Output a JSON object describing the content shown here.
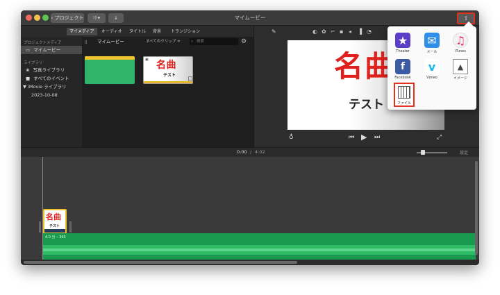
{
  "titlebar": {
    "back_label": "‹ プロジェクト",
    "view_label": "⁝⁝⁝▾",
    "import_icon": "↓",
    "title": "マイムービー",
    "share_icon": "⇧"
  },
  "browser": {
    "tabs": [
      "マイメディア",
      "オーディオ",
      "タイトル",
      "背景",
      "トランジション"
    ],
    "active_tab": 0
  },
  "sidebar": {
    "project_media_header": "プロジェクトメディア",
    "project_item": "マイムービー",
    "library_header": "ライブラリ",
    "library_items": [
      "写真ライブラリ",
      "すべてのイベント"
    ],
    "imovie_library": "▼ iMovie ライブラリ",
    "event_date": "2023-10-08"
  },
  "content": {
    "title": "マイムービー",
    "filter": "すべてのクリップ ≑",
    "search_placeholder": "検索",
    "clip_title_main": "名曲",
    "clip_title_sub": "テスト"
  },
  "viewer": {
    "title_main": "名曲",
    "title_sub": "テスト"
  },
  "share_menu": {
    "items": [
      "Theater",
      "メール",
      "iTunes",
      "Facebook",
      "Vimeo",
      "イメージ",
      "ファイル"
    ],
    "highlighted": "ファイル"
  },
  "timeline": {
    "time_current": "0:00",
    "time_separator": "/",
    "time_total": "4:02",
    "settings_label": "設定",
    "clip_title_main": "名曲",
    "clip_title_sub": "テスト",
    "audio_label": "4.0 分 – 365"
  },
  "colors": {
    "share_highlight": "#e0301e",
    "title_red": "#e0201c",
    "audio_green": "#1a9a4e"
  }
}
